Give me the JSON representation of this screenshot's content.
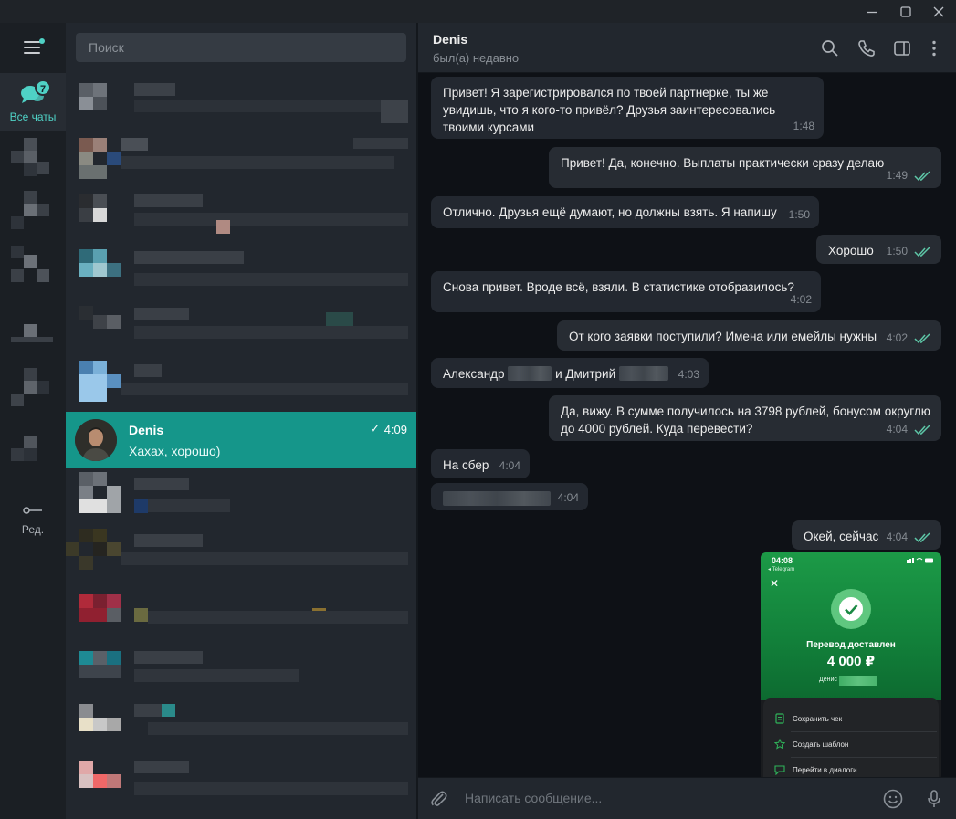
{
  "colors": {
    "accent": "#4fd1c5",
    "active_row": "#15968a",
    "background": "#0e1116",
    "bubble": "#232830",
    "check": "#5ec8a8"
  },
  "window": {
    "minimize_icon": "minimize-icon",
    "maximize_icon": "maximize-icon",
    "close_icon": "close-icon"
  },
  "rail": {
    "all_chats_label": "Все чаты",
    "unread_badge": "7",
    "edit_label": "Ред."
  },
  "search": {
    "placeholder": "Поиск"
  },
  "active_chat": {
    "name": "Denis",
    "preview": "Хахах, хорошо)",
    "time": "4:09",
    "check": "✓"
  },
  "header": {
    "name": "Denis",
    "status": "был(а) недавно"
  },
  "messages": [
    {
      "dir": "in",
      "text": "Привет! Я зарегистрировался по твоей партнерке, ты же увидишь, что я кого-то привёл? Друзья заинтересовались твоими курсами",
      "time": "1:48"
    },
    {
      "dir": "out",
      "text": "Привет! Да, конечно. Выплаты практически сразу делаю",
      "time": "1:49"
    },
    {
      "dir": "in",
      "text": "Отлично. Друзья ещё думают, но должны взять. Я напишу",
      "time": "1:50"
    },
    {
      "dir": "out",
      "text": "Хорошо",
      "time": "1:50"
    },
    {
      "dir": "in",
      "text": "Снова привет. Вроде всё, взяли. В статистике отобразилось?",
      "time": "4:02"
    },
    {
      "dir": "out",
      "text": "От кого заявки поступили? Имена или емейлы нужны",
      "time": "4:02"
    },
    {
      "dir": "in",
      "text_a": "Александр",
      "text_b": "и Дмитрий",
      "time": "4:03"
    },
    {
      "dir": "out",
      "text": "Да, вижу. В сумме получилось на 3798 рублей, бонусом округлю до 4000 рублей. Куда перевести?",
      "time": "4:04"
    },
    {
      "dir": "in",
      "text": "На сбер",
      "time": "4:04"
    },
    {
      "dir": "in",
      "text": "",
      "time": "4:04"
    },
    {
      "dir": "out",
      "text": "Окей, сейчас",
      "time": "4:04"
    }
  ],
  "receipt": {
    "time": "04:08",
    "source": "◂ Telegram",
    "title": "Перевод доставлен",
    "amount": "4 000 ₽",
    "recipient": "Денис",
    "actions": [
      "Сохранить чек",
      "Создать шаблон",
      "Перейти в диалоги"
    ]
  },
  "composer": {
    "placeholder": "Написать сообщение..."
  }
}
